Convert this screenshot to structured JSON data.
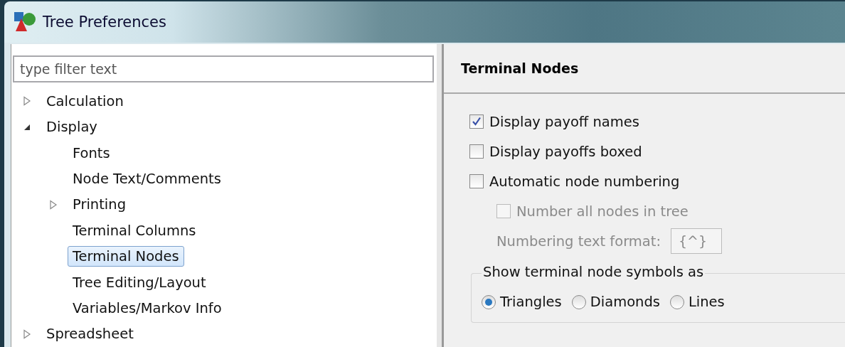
{
  "window": {
    "title": "Tree Preferences"
  },
  "filter": {
    "placeholder": "type filter text"
  },
  "tree": [
    {
      "label": "Calculation",
      "selected": false,
      "expanded": false
    },
    {
      "label": "Display",
      "selected": false,
      "expanded": true,
      "children": [
        {
          "label": "Fonts",
          "selected": false
        },
        {
          "label": "Node Text/Comments",
          "selected": false
        },
        {
          "label": "Printing",
          "selected": false,
          "expanded": false
        },
        {
          "label": "Terminal Columns",
          "selected": false
        },
        {
          "label": "Terminal Nodes",
          "selected": true
        },
        {
          "label": "Tree Editing/Layout",
          "selected": false
        },
        {
          "label": "Variables/Markov Info",
          "selected": false
        }
      ]
    },
    {
      "label": "Spreadsheet",
      "selected": false,
      "expanded": false
    }
  ],
  "page": {
    "title": "Terminal Nodes",
    "options": [
      {
        "kind": "checkbox",
        "label": "Display payoff names",
        "checked": true,
        "disabled": false
      },
      {
        "kind": "checkbox",
        "label": "Display payoffs boxed",
        "checked": false,
        "disabled": false
      },
      {
        "kind": "checkbox",
        "label": "Automatic node numbering",
        "checked": false,
        "disabled": false,
        "children": [
          {
            "kind": "checkbox",
            "label": "Number all nodes in tree",
            "checked": false,
            "disabled": true
          },
          {
            "kind": "text",
            "label": "Numbering text format:",
            "value": "{^}",
            "disabled": true
          }
        ]
      }
    ],
    "group": {
      "title": "Show terminal node symbols as",
      "radios": [
        {
          "label": "Triangles",
          "selected": true
        },
        {
          "label": "Diamonds",
          "selected": false
        },
        {
          "label": "Lines",
          "selected": false
        }
      ]
    }
  }
}
